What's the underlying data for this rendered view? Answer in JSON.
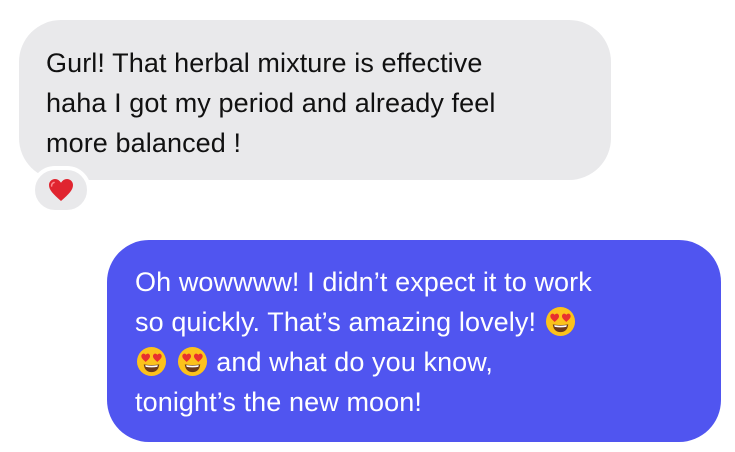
{
  "conversation": {
    "incoming": {
      "lines": [
        "Gurl! That herbal mixture is effective",
        "haha I got my period and already feel",
        "more balanced !"
      ],
      "reaction_icon": "red-heart-emoji",
      "bubble_color": "#e9e9eb"
    },
    "outgoing": {
      "line1": "Oh wowwww! I didn’t expect it to work",
      "line2": "so quickly. That’s amazing lovely!",
      "line3": "and what do you know,",
      "line4": "tonight’s the new moon!",
      "emoji_icon": "smiling-face-with-heart-eyes-emoji",
      "bubble_color": "#5055f0"
    }
  }
}
